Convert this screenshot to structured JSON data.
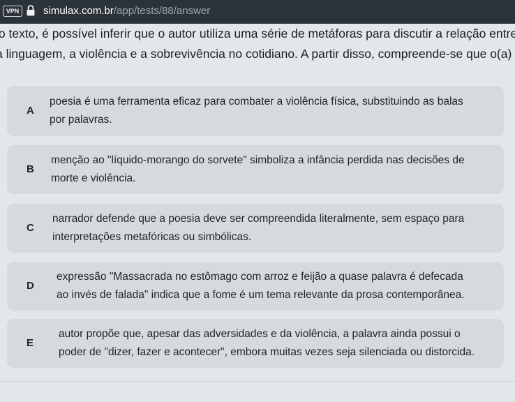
{
  "browser": {
    "vpn_label": "VPN",
    "url_host": "simulax.com.br",
    "url_path": "/app/tests/88/answer"
  },
  "question": {
    "stem_line1": "lo texto, é possível inferir que o autor utiliza uma série de metáforas para discutir a relação entre",
    "stem_line2": "a linguagem, a violência e a sobrevivência no cotidiano. A partir disso, compreende-se que o(a)"
  },
  "options": [
    {
      "letter": "A",
      "line1": "poesia é uma ferramenta eficaz para combater a violência física, substituindo as balas",
      "line2": "por palavras."
    },
    {
      "letter": "B",
      "line1": "menção ao \"líquido-morango do sorvete\" simboliza a infância perdida nas decisões de",
      "line2": "morte e violência."
    },
    {
      "letter": "C",
      "line1": "narrador defende que a poesia deve ser compreendida literalmente, sem espaço para",
      "line2": "interpretações metafóricas ou simbólicas."
    },
    {
      "letter": "D",
      "line1": "expressão \"Massacrada no estômago com arroz e feijão a quase palavra é defecada",
      "line2": "ao invés de falada\" indica que a fome é um tema relevante da prosa contemporânea."
    },
    {
      "letter": "E",
      "line1": "autor propõe que, apesar das adversidades e da violência, a palavra ainda possui o",
      "line2": "poder de \"dizer, fazer e acontecer\", embora muitas vezes seja silenciada ou distorcida."
    }
  ],
  "icons": {
    "lock": "lock-icon"
  }
}
